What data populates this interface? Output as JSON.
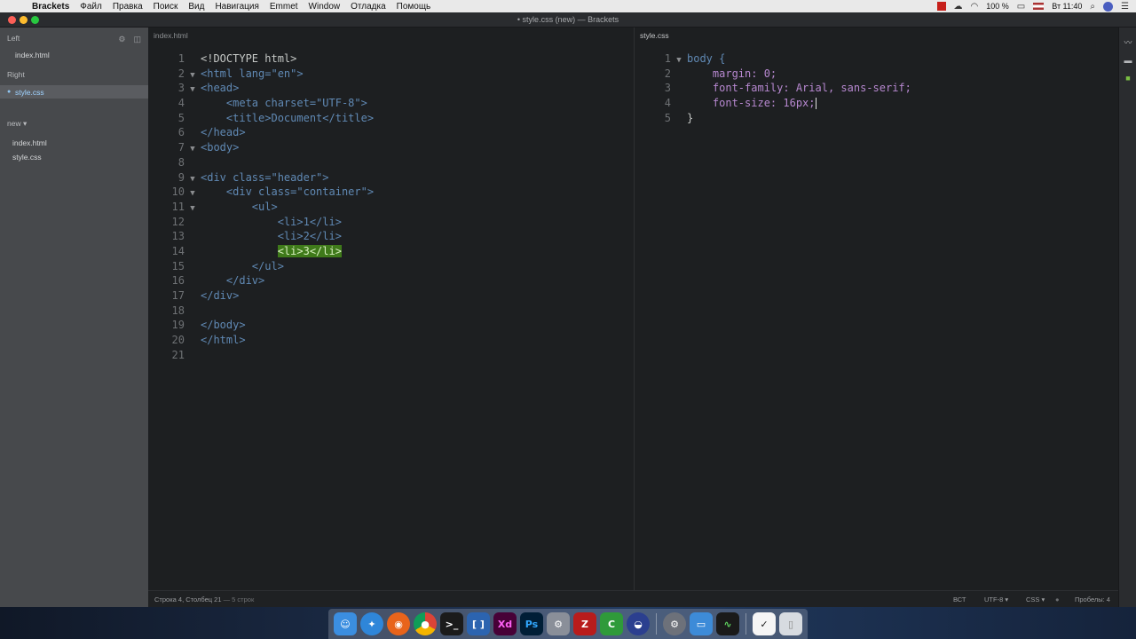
{
  "menubar": {
    "apple": "",
    "app_name": "Brackets",
    "items": [
      "Файл",
      "Правка",
      "Поиск",
      "Вид",
      "Навигация",
      "Emmet",
      "Window",
      "Отладка",
      "Помощь"
    ],
    "battery": "100 %",
    "clock": "Вт 11:40"
  },
  "window": {
    "title": "• style.css (new) — Brackets"
  },
  "sidebar": {
    "left_header": "Left",
    "left_files": [
      "index.html"
    ],
    "right_header": "Right",
    "right_files": [
      "style.css"
    ],
    "project_header": "new ▾",
    "project_files": [
      "index.html",
      "style.css"
    ]
  },
  "left_pane": {
    "tab": "index.html",
    "line_numbers": [
      "1",
      "2",
      "3",
      "4",
      "5",
      "6",
      "7",
      "8",
      "9",
      "10",
      "11",
      "12",
      "13",
      "14",
      "15",
      "16",
      "17",
      "18",
      "19",
      "20",
      "21"
    ],
    "lines": [
      {
        "indent": "",
        "text": "<!DOCTYPE html>"
      },
      {
        "indent": "",
        "text": "<html lang=\"en\">"
      },
      {
        "indent": "",
        "text": "<head>"
      },
      {
        "indent": "    ",
        "text": "<meta charset=\"UTF-8\">"
      },
      {
        "indent": "    ",
        "text": "<title>Document</title>"
      },
      {
        "indent": "",
        "text": "</head>"
      },
      {
        "indent": "",
        "text": "<body>"
      },
      {
        "indent": "",
        "text": ""
      },
      {
        "indent": "",
        "text": "<div class=\"header\">"
      },
      {
        "indent": "    ",
        "text": "<div class=\"container\">"
      },
      {
        "indent": "        ",
        "text": "<ul>"
      },
      {
        "indent": "            ",
        "text": "<li>1</li>"
      },
      {
        "indent": "            ",
        "text": "<li>2</li>"
      },
      {
        "indent": "            ",
        "text": "<li>3</li>"
      },
      {
        "indent": "        ",
        "text": "</ul>"
      },
      {
        "indent": "    ",
        "text": "</div>"
      },
      {
        "indent": "",
        "text": "</div>"
      },
      {
        "indent": "",
        "text": ""
      },
      {
        "indent": "",
        "text": "</body>"
      },
      {
        "indent": "",
        "text": "</html>"
      },
      {
        "indent": "",
        "text": ""
      }
    ]
  },
  "right_pane": {
    "tab": "style.css",
    "line_numbers": [
      "1",
      "2",
      "3",
      "4",
      "5"
    ],
    "lines": [
      "body {",
      "    margin: 0;",
      "    font-family: Arial, sans-serif;",
      "    font-size: 16px;",
      "}"
    ]
  },
  "statusbar": {
    "position": "Строка 4, Столбец 21",
    "line_count": "— 5 строк",
    "mode": "ВСТ",
    "encoding": "UTF-8 ▾",
    "language": "CSS ▾",
    "spaces": "Пробелы: 4"
  },
  "dock": {
    "icons": [
      "finder-icon",
      "safari-icon",
      "firefox-icon",
      "chrome-icon",
      "terminal-icon",
      "brackets-icon",
      "xd-icon",
      "photoshop-icon",
      "system-icon",
      "filezilla-icon",
      "camtasia-icon",
      "ftp-icon",
      "preferences-icon",
      "keynote-icon",
      "activity-monitor-icon",
      "todo-icon",
      "trash-icon"
    ]
  }
}
